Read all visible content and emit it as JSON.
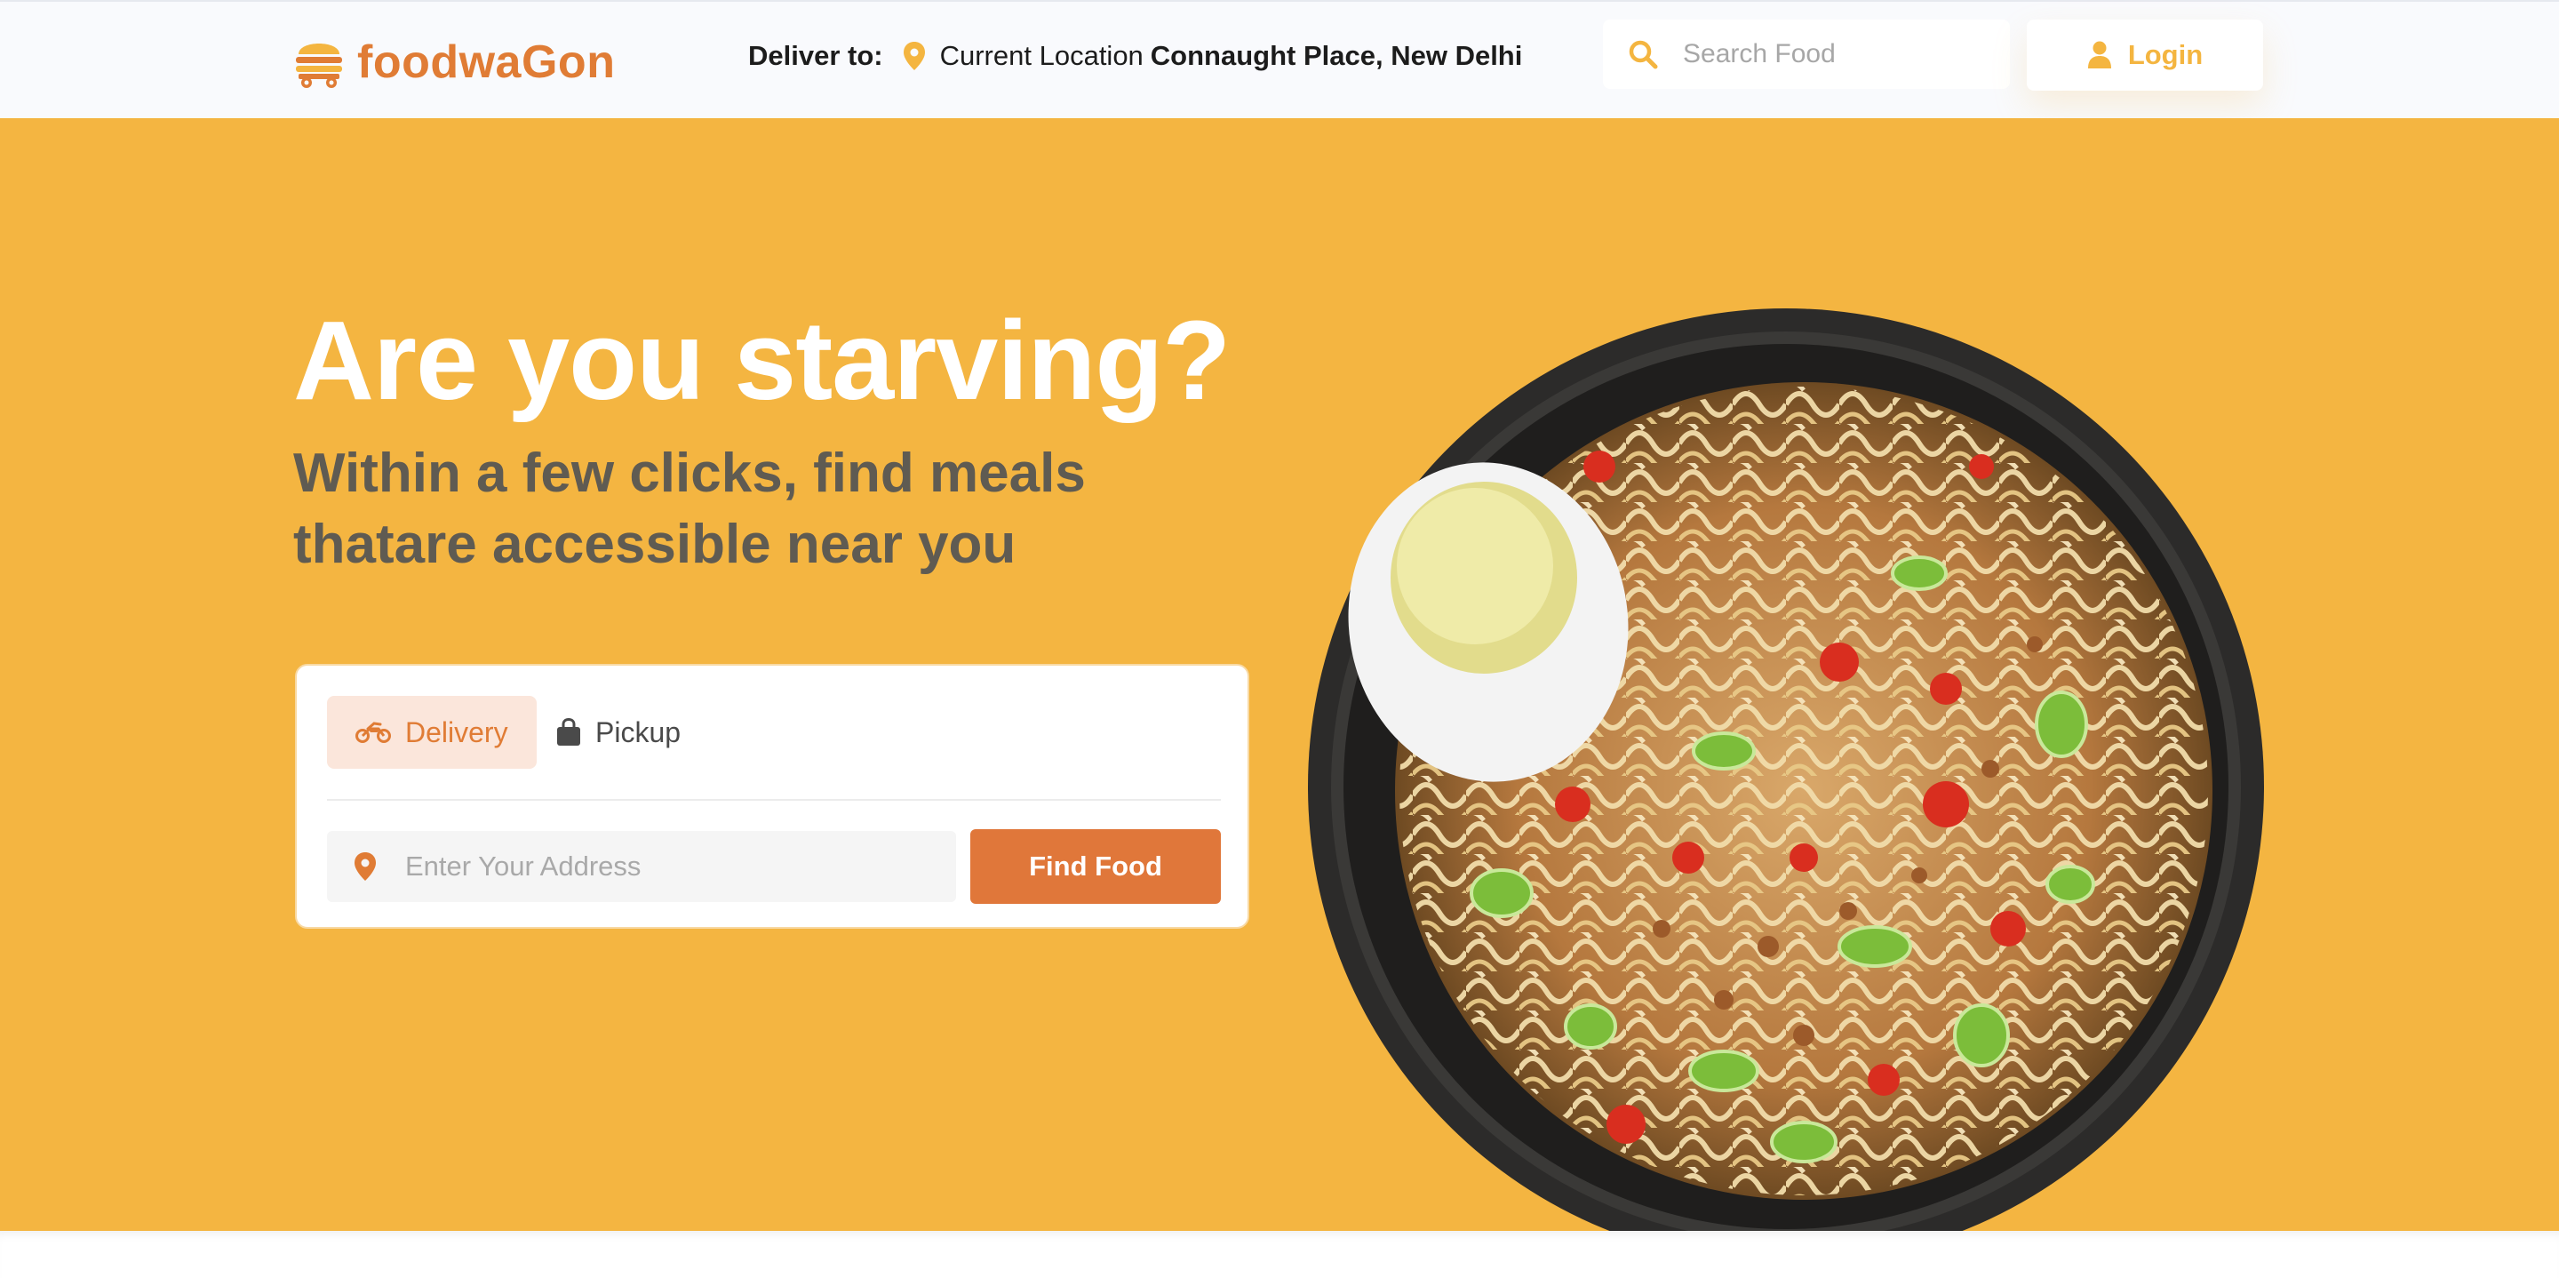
{
  "navbar": {
    "brand": {
      "name_part1": "foodwa",
      "name_part2": "Gon",
      "logo_icon": "food-truck-icon"
    },
    "deliver_to": {
      "label": "Deliver to:",
      "pin_icon": "location-pin-icon",
      "current_label": "Current Location",
      "location": "Connaught Place, New Delhi"
    },
    "search": {
      "icon": "search-icon",
      "placeholder": "Search Food"
    },
    "login": {
      "icon": "user-icon",
      "label": "Login"
    }
  },
  "hero": {
    "headline": "Are you starving?",
    "subline": "Within a few clicks, find meals thatare accessible near you",
    "image": "noodle-bowl-with-egg",
    "card": {
      "tabs": [
        {
          "label": "Delivery",
          "icon": "motorcycle-icon",
          "active": true
        },
        {
          "label": "Pickup",
          "icon": "shopping-bag-icon",
          "active": false
        }
      ],
      "address": {
        "icon": "location-pin-icon",
        "placeholder": "Enter Your Address",
        "value": ""
      },
      "find_button": "Find Food"
    }
  },
  "colors": {
    "primary_orange": "#e07c35",
    "accent_yellow": "#f4b540",
    "hero_background": "#f4b541",
    "navbar_background": "#f9fafd",
    "subline_text": "#5f5b52",
    "active_tab_background": "#fbe6db"
  }
}
